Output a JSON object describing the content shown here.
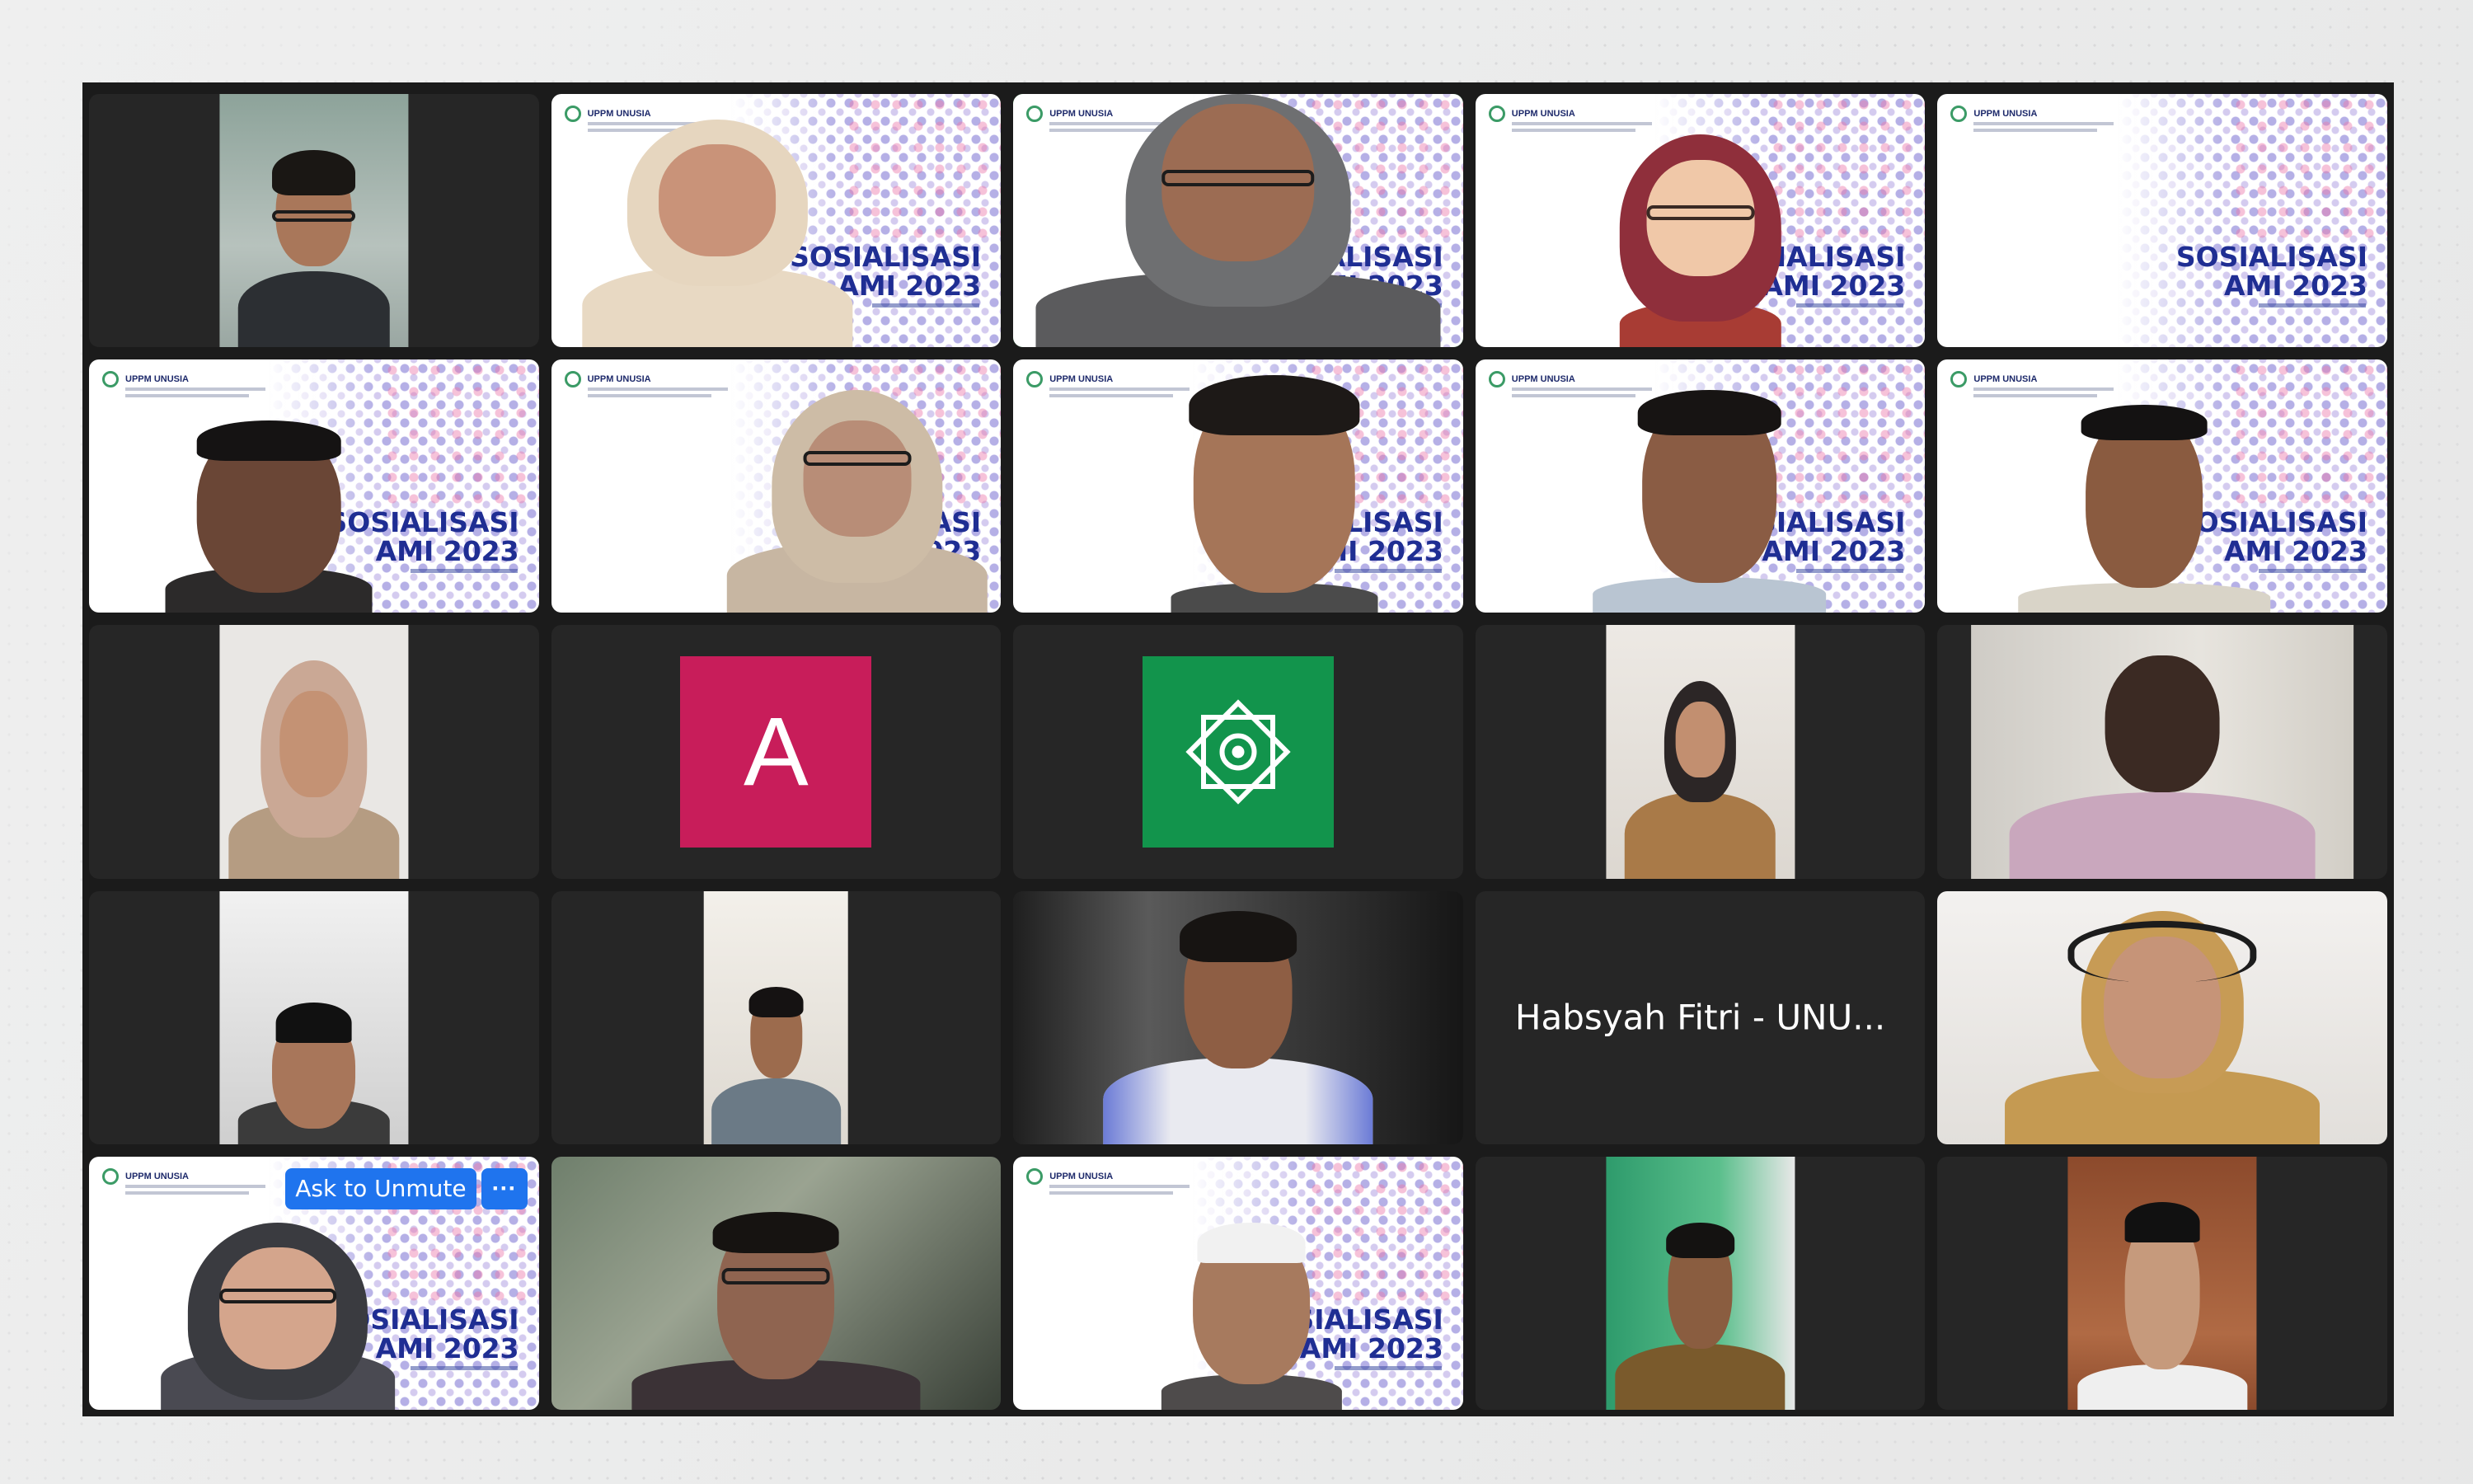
{
  "slide": {
    "org": "UPPM UNUSIA",
    "title_line1": "SOSIALISASI",
    "title_line2": "AMI 2023"
  },
  "tiles": {
    "avatar_letter": "A",
    "name_label": "Habsyah Fitri - UNU...",
    "unmute_button": "Ask to Unmute",
    "more_button": "···"
  },
  "colors": {
    "active_speaker_border": "#36d35a",
    "avatar_a_bg": "#c81d5a",
    "avatar_logo_bg": "#12944c",
    "button_blue": "#1f74ee",
    "slide_title": "#1f2e93"
  },
  "icons": {
    "avatar_logo": "octagram-ornament-icon"
  }
}
